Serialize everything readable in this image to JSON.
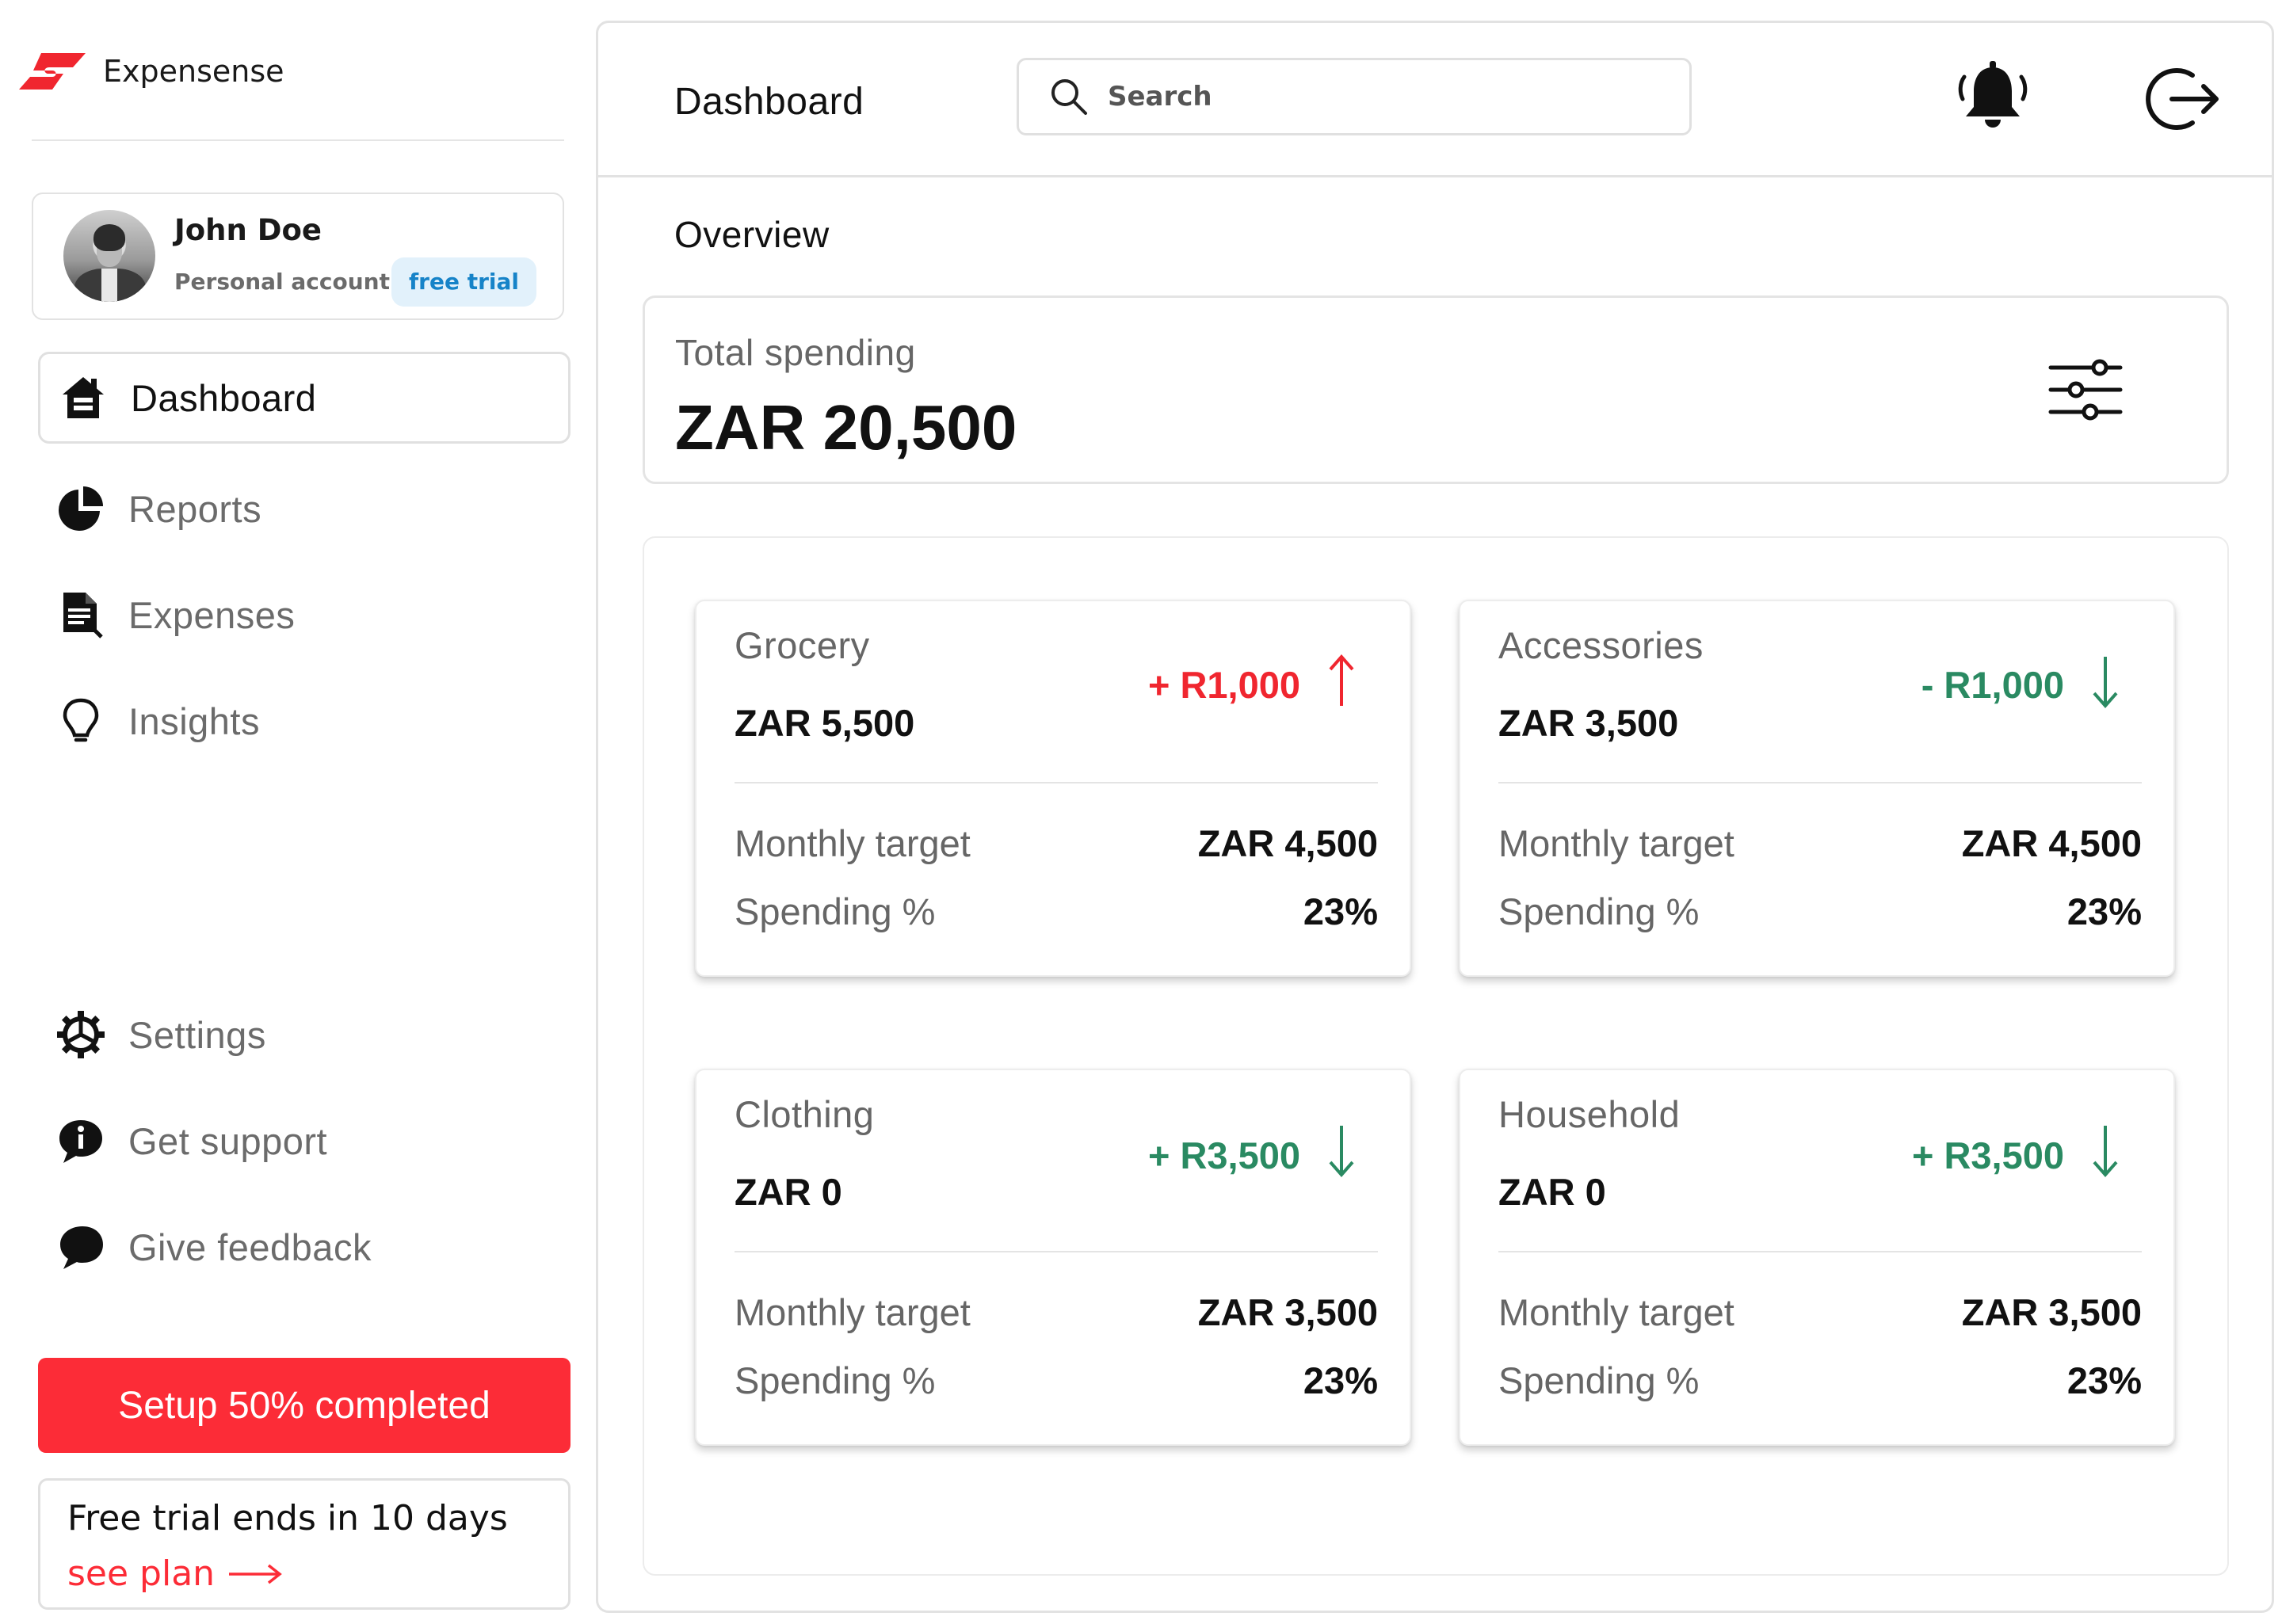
{
  "app": {
    "name": "Expensense",
    "brand_color": "#fc2c37"
  },
  "profile": {
    "name": "John Doe",
    "account_type": "Personal account",
    "badge": "free trial"
  },
  "sidebar": {
    "primary": [
      {
        "label": "Dashboard",
        "icon": "home-icon",
        "active": true
      },
      {
        "label": "Reports",
        "icon": "pie-chart-icon",
        "active": false
      },
      {
        "label": "Expenses",
        "icon": "document-icon",
        "active": false
      },
      {
        "label": "Insights",
        "icon": "lightbulb-icon",
        "active": false
      }
    ],
    "secondary": [
      {
        "label": "Settings",
        "icon": "gear-icon"
      },
      {
        "label": "Get support",
        "icon": "info-chat-icon"
      },
      {
        "label": "Give feedback",
        "icon": "chat-bubble-icon"
      }
    ],
    "setup_button": "Setup 50% completed",
    "trial_notice": "Free trial ends in 10 days",
    "see_plan": "see plan"
  },
  "header": {
    "title": "Dashboard",
    "search_placeholder": "Search"
  },
  "overview": {
    "title": "Overview",
    "total_label": "Total spending",
    "total_value": "ZAR 20,500"
  },
  "categories": [
    {
      "name": "Grocery",
      "amount": "ZAR 5,500",
      "delta": "+ R1,000",
      "trend": "up",
      "target_label": "Monthly target",
      "target": "ZAR 4,500",
      "spending_label": "Spending %",
      "spending": "23%"
    },
    {
      "name": "Accessories",
      "amount": "ZAR 3,500",
      "delta": "- R1,000",
      "trend": "down",
      "target_label": "Monthly target",
      "target": "ZAR 4,500",
      "spending_label": "Spending %",
      "spending": "23%"
    },
    {
      "name": "Clothing",
      "amount": "ZAR 0",
      "delta": "+ R3,500",
      "trend": "down",
      "target_label": "Monthly target",
      "target": "ZAR 3,500",
      "spending_label": "Spending %",
      "spending": "23%"
    },
    {
      "name": "Household",
      "amount": "ZAR 0",
      "delta": "+ R3,500",
      "trend": "down",
      "target_label": "Monthly target",
      "target": "ZAR 3,500",
      "spending_label": "Spending %",
      "spending": "23%"
    }
  ],
  "colors": {
    "increase": "#f0262f",
    "decrease": "#2a8a62",
    "badge_bg": "#e2f1fb",
    "badge_text": "#1683c8"
  }
}
